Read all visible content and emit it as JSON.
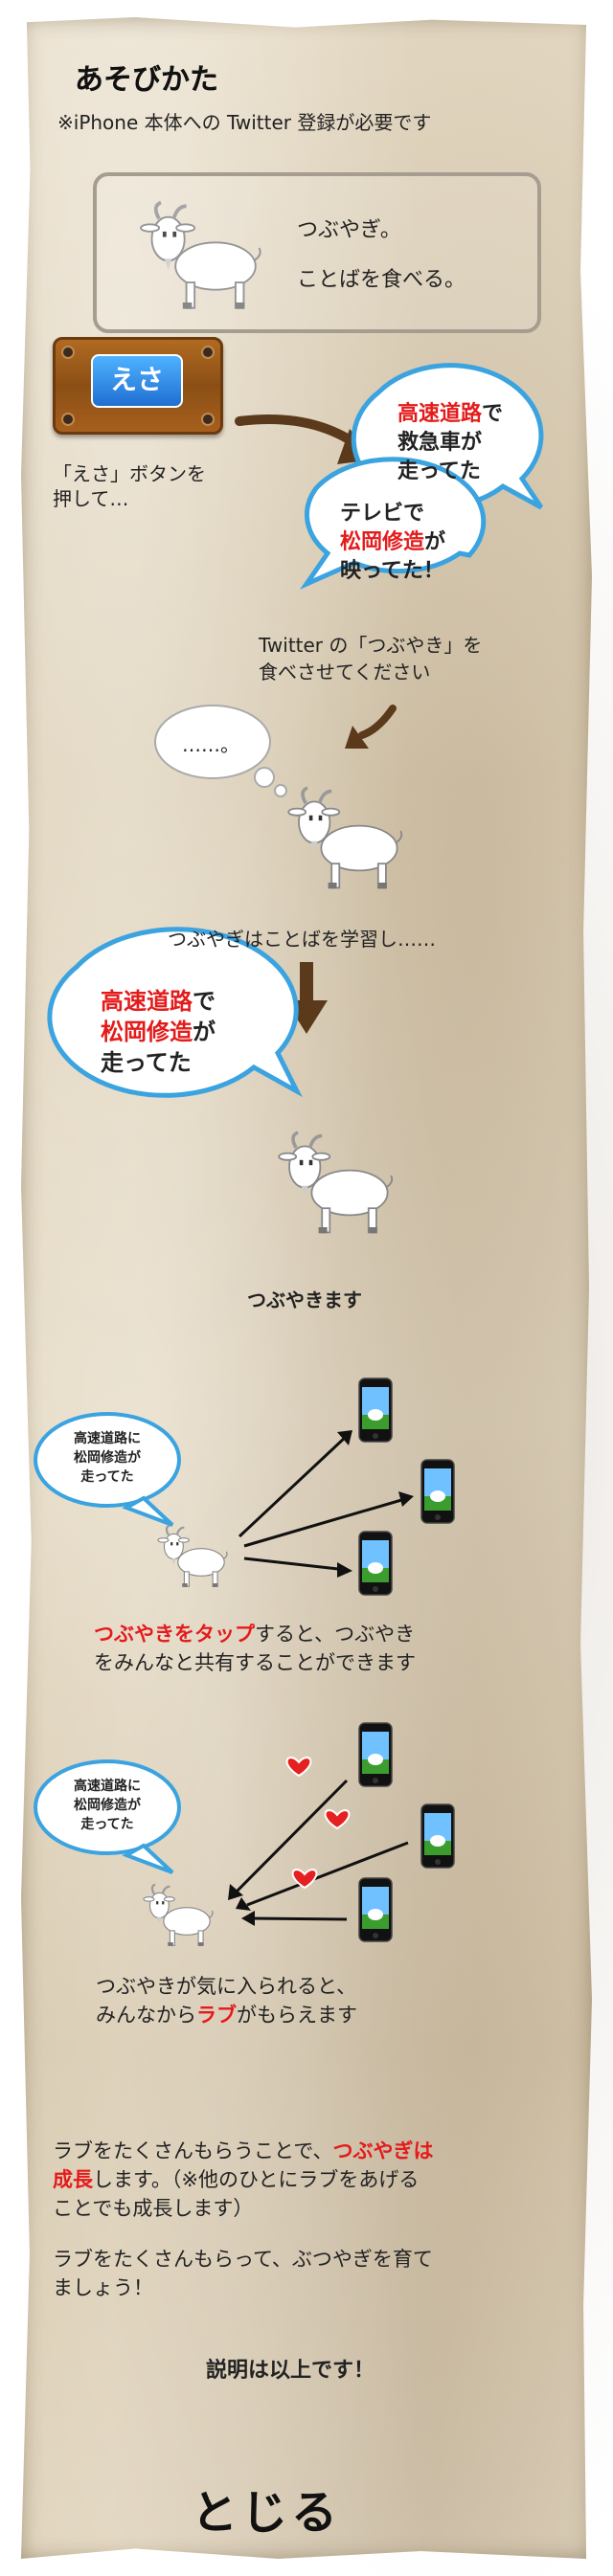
{
  "header": {
    "title": "あそびかた",
    "requirement_note": "※iPhone 本体への Twitter 登録が必要です"
  },
  "intro": {
    "line1": "つぶやぎ。",
    "line2": "ことばを食べる。"
  },
  "feed": {
    "button_label": "えさ",
    "caption_line1": "「えさ」ボタンを",
    "caption_line2": "押して…",
    "bubble1": [
      "高速道路",
      "で",
      "救急車が",
      "走ってた"
    ],
    "bubble2": [
      "テレビで",
      "松岡修造",
      "が",
      "映ってた！"
    ],
    "twitter_caption_line1": "Twitter の「つぶやき」を",
    "twitter_caption_line2": "食べさせてください",
    "thought": "……。"
  },
  "learn": {
    "caption": "つぶやぎはことばを学習し……",
    "bubble": [
      "高速道路",
      "で",
      "松岡修造",
      "が",
      "走ってた"
    ],
    "tweet_caption": "つぶやきます"
  },
  "share": {
    "bubble": [
      "高速道路に",
      "松岡修造が",
      "走ってた"
    ],
    "caption_line1_red": "つぶやきをタップ",
    "caption_line1_rest": "すると、つぶやき",
    "caption_line2": "をみんなと共有することができます"
  },
  "love": {
    "bubble": [
      "高速道路に",
      "松岡修造が",
      "走ってた"
    ],
    "caption_line1": "つぶやきが気に入られると、",
    "caption_line2_a": "みんなから",
    "caption_line2_red": "ラブ",
    "caption_line2_b": "がもらえます"
  },
  "growth": {
    "p1_a": "ラブをたくさんもらうことで、",
    "p1_red": "つぶやぎは",
    "p1_bold": "成長",
    "p1_b": "します。（※他のひとにラブをあげる",
    "p1_c": "ことでも成長します）",
    "p2_a": "ラブをたくさんもらって、ぶつやぎを育て",
    "p2_b": "ましょう！",
    "end": "説明は以上です！"
  },
  "footer": {
    "close_label": "とじる"
  },
  "colors": {
    "accent_red": "#e41b1b",
    "button_blue": "#1f6fd1",
    "plank_brown": "#8b4f15"
  }
}
